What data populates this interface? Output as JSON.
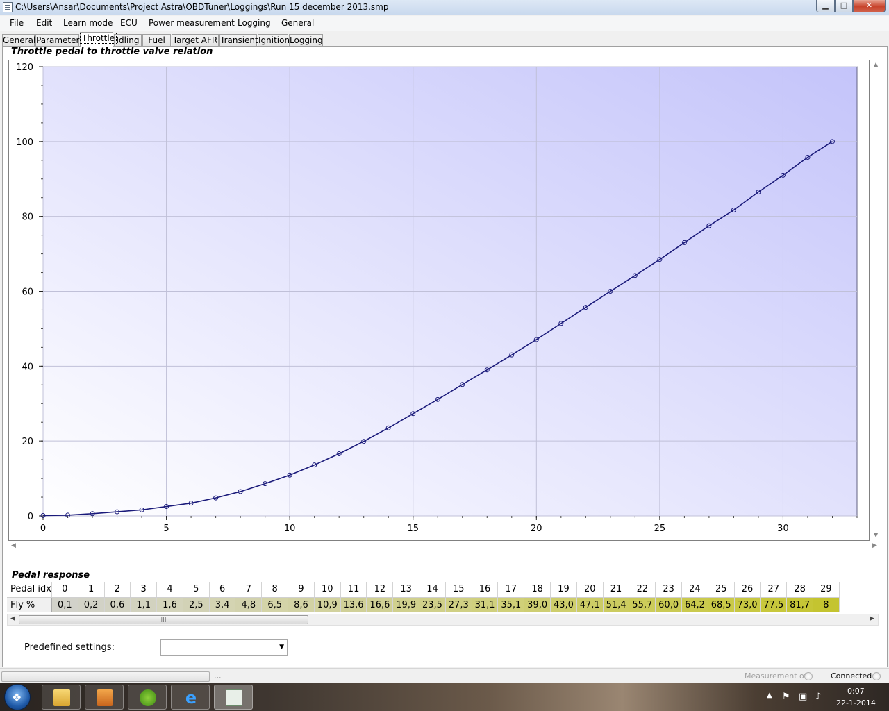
{
  "window": {
    "title": "C:\\Users\\Ansar\\Documents\\Project Astra\\OBDTuner\\Loggings\\Run 15 december 2013.smp",
    "minimize": "▁",
    "maximize": "□",
    "close": "✕"
  },
  "menu": [
    "File",
    "Edit",
    "Learn mode",
    "ECU",
    "Power measurement",
    "Logging",
    "General"
  ],
  "tabs": [
    "General",
    "Parameters",
    "Throttle",
    "Idling",
    "Fuel",
    "Target AFR",
    "Transient",
    "Ignition",
    "Logging"
  ],
  "active_tab": "Throttle",
  "chart_group_title": "Throttle pedal to throttle valve relation",
  "chart_data": {
    "type": "line",
    "title": "",
    "xlabel": "",
    "ylabel": "",
    "xlim": [
      0,
      33
    ],
    "ylim": [
      0,
      120
    ],
    "x_ticks": [
      0,
      5,
      10,
      15,
      20,
      25,
      30
    ],
    "y_ticks": [
      0,
      20,
      40,
      60,
      80,
      100,
      120
    ],
    "grid": true,
    "background_gradient": [
      "#ffffff",
      "#c4c4fa"
    ],
    "line_color": "#1a1a7a",
    "marker": "circle",
    "series": [
      {
        "x": [
          0,
          1,
          2,
          3,
          4,
          5,
          6,
          7,
          8,
          9,
          10,
          11,
          12,
          13,
          14,
          15,
          16,
          17,
          18,
          19,
          20,
          21,
          22,
          23,
          24,
          25,
          26,
          27,
          28,
          29,
          30,
          31,
          32
        ],
        "values": [
          0.1,
          0.2,
          0.6,
          1.1,
          1.6,
          2.5,
          3.4,
          4.8,
          6.5,
          8.6,
          10.9,
          13.6,
          16.6,
          19.9,
          23.5,
          27.3,
          31.1,
          35.1,
          39.0,
          43.0,
          47.1,
          51.4,
          55.7,
          60.0,
          64.2,
          68.5,
          73.0,
          77.5,
          81.7,
          86.5,
          91.0,
          95.8,
          100.0
        ]
      }
    ]
  },
  "pedal_response": {
    "title": "Pedal response",
    "row_labels": [
      "Pedal idx",
      "Fly %"
    ],
    "pedal_idx": [
      "0",
      "1",
      "2",
      "3",
      "4",
      "5",
      "6",
      "7",
      "8",
      "9",
      "10",
      "11",
      "12",
      "13",
      "14",
      "15",
      "16",
      "17",
      "18",
      "19",
      "20",
      "21",
      "22",
      "23",
      "24",
      "25",
      "26",
      "27",
      "28",
      "29"
    ],
    "fly_values": [
      "0,1",
      "0,2",
      "0,6",
      "1,1",
      "1,6",
      "2,5",
      "3,4",
      "4,8",
      "6,5",
      "8,6",
      "10,9",
      "13,6",
      "16,6",
      "19,9",
      "23,5",
      "27,3",
      "31,1",
      "35,1",
      "39,0",
      "43,0",
      "47,1",
      "51,4",
      "55,7",
      "60,0",
      "64,2",
      "68,5",
      "73,0",
      "77,5",
      "81,7",
      "8"
    ],
    "cell_colors": [
      "#d2d2ca",
      "#d2d2c6",
      "#d2d2c2",
      "#d2d2bf",
      "#d4d4bb",
      "#d2d2b6",
      "#d4d4b2",
      "#d2d2ad",
      "#d4d4a8",
      "#d2d2a4",
      "#d2d29e",
      "#d0d098",
      "#d0d094",
      "#d0d08e",
      "#d0d08a",
      "#d0d084",
      "#d0d07e",
      "#d0d078",
      "#cece72",
      "#cece6c",
      "#cccc66",
      "#cccc60",
      "#cccc5a",
      "#caca54",
      "#caca4e",
      "#caca48",
      "#c8c842",
      "#c8c83c",
      "#c6c636",
      "#c4c430"
    ]
  },
  "predefined": {
    "label": "Predefined settings:",
    "value": ""
  },
  "status": {
    "dots": "...",
    "measurement": "Measurement off",
    "connection": "Connected"
  },
  "taskbar": {
    "time": "0:07",
    "date": "22-1-2014",
    "apps": [
      "explorer-icon",
      "media-player-icon",
      "spotify-icon",
      "internet-explorer-icon",
      "obdtuner-icon"
    ]
  }
}
